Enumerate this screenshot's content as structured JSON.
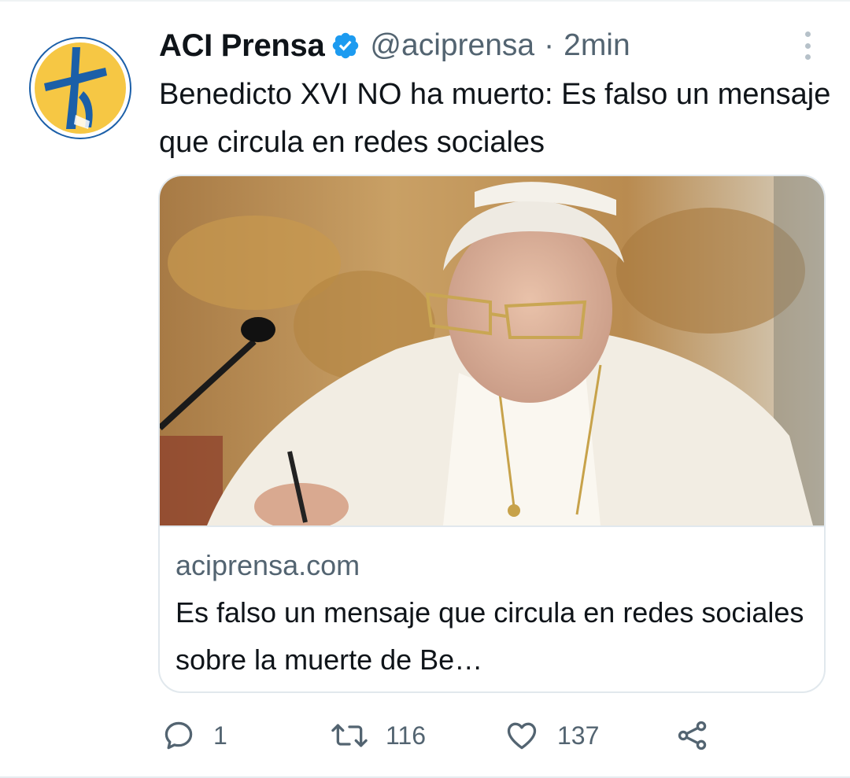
{
  "tweet": {
    "display_name": "ACI Prensa",
    "handle": "@aciprensa",
    "separator": "·",
    "time": "2min",
    "text": "Benedicto XVI NO ha muerto: Es falso un mensaje que circula en redes sociales"
  },
  "card": {
    "domain": "aciprensa.com",
    "title": "Es falso un mensaje que circula en redes sociales sobre la muerte de Be…"
  },
  "actions": {
    "reply_count": "1",
    "retweet_count": "116",
    "like_count": "137"
  },
  "colors": {
    "verified": "#1d9bf0",
    "secondary_text": "#536471",
    "primary_text": "#0f1419",
    "avatar_blue": "#1b5fa8",
    "avatar_yellow": "#f6c744"
  },
  "icons": {
    "more": "more-vertical-icon",
    "verified": "verified-badge-icon",
    "reply": "reply-icon",
    "retweet": "retweet-icon",
    "like": "heart-icon",
    "share": "share-icon"
  }
}
